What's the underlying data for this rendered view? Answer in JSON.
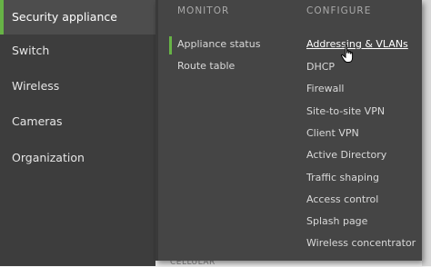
{
  "sidebar": {
    "items": [
      {
        "label": "Security appliance",
        "active": true
      },
      {
        "label": "Switch"
      },
      {
        "label": "Wireless"
      },
      {
        "label": "Cameras"
      },
      {
        "label": "Organization"
      }
    ]
  },
  "flyout": {
    "monitor": {
      "header": "MONITOR",
      "items": [
        "Appliance status",
        "Route table"
      ]
    },
    "configure": {
      "header": "CONFIGURE",
      "items": [
        "Addressing & VLANs",
        "DHCP",
        "Firewall",
        "Site-to-site VPN",
        "Client VPN",
        "Active Directory",
        "Traffic shaping",
        "Access control",
        "Splash page",
        "Wireless concentrator"
      ]
    }
  },
  "background": {
    "section_label": "CELLULAR"
  },
  "colors": {
    "sidebar_bg": "#3d3d3d",
    "flyout_bg": "#454545",
    "accent_green": "#67b346"
  },
  "icons": {
    "cursor": "hand-pointer-icon"
  }
}
